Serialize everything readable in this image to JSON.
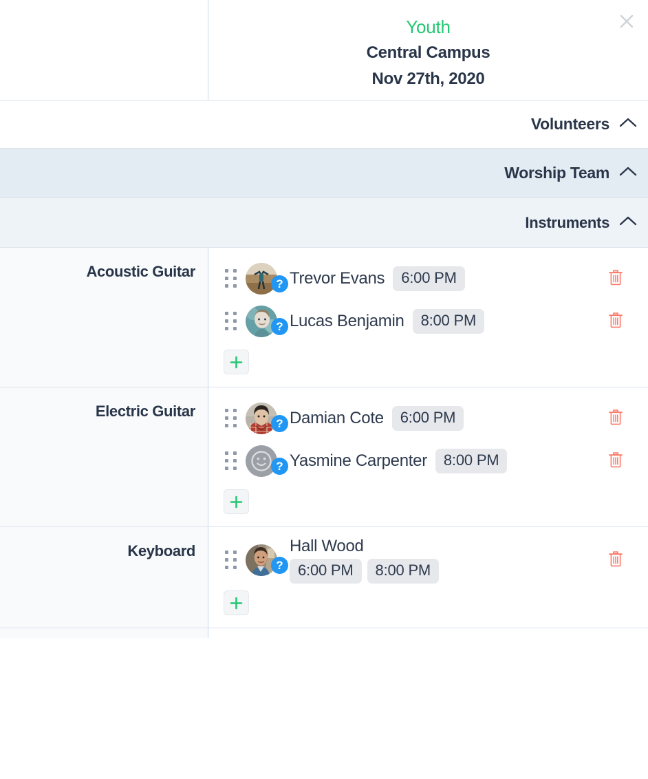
{
  "header": {
    "service_type": "Youth",
    "campus": "Central Campus",
    "date": "Nov 27th, 2020",
    "close_label": "×"
  },
  "colors": {
    "accent_green": "#25c772",
    "text_dark": "#293548",
    "badge_blue": "#2196f3",
    "trash_red": "#fb7b6b",
    "pill_bg": "#e6e8ec",
    "band_worship_bg": "#e3ebf3",
    "band_instruments_bg": "#eef3f8",
    "label_cell_bg": "#f8fafc"
  },
  "bands": [
    {
      "label": "Volunteers",
      "icon": "chevron-up-icon",
      "expanded": true
    },
    {
      "label": "Worship Team",
      "icon": "chevron-up-icon",
      "expanded": true
    },
    {
      "label": "Instruments",
      "icon": "chevron-up-icon",
      "expanded": true
    }
  ],
  "positions": [
    {
      "name": "Acoustic Guitar",
      "add_label": "+",
      "people": [
        {
          "name": "Trevor Evans",
          "status_icon": "question-badge-icon",
          "status_symbol": "?",
          "avatar": "photo-jumping-person",
          "times": [
            "6:00 PM"
          ],
          "stacked": false,
          "drag_icon": "drag-handle-icon",
          "delete_icon": "trash-icon"
        },
        {
          "name": "Lucas Benjamin",
          "status_icon": "question-badge-icon",
          "status_symbol": "?",
          "avatar": "photo-young-man-teal",
          "times": [
            "8:00 PM"
          ],
          "stacked": false,
          "drag_icon": "drag-handle-icon",
          "delete_icon": "trash-icon"
        }
      ]
    },
    {
      "name": "Electric Guitar",
      "add_label": "+",
      "people": [
        {
          "name": "Damian Cote",
          "status_icon": "question-badge-icon",
          "status_symbol": "?",
          "avatar": "photo-man-plaid-shirt",
          "times": [
            "6:00 PM"
          ],
          "stacked": false,
          "drag_icon": "drag-handle-icon",
          "delete_icon": "trash-icon"
        },
        {
          "name": "Yasmine Carpenter",
          "status_icon": "question-badge-icon",
          "status_symbol": "?",
          "avatar": "placeholder-smiley-avatar",
          "times": [
            "8:00 PM"
          ],
          "stacked": false,
          "drag_icon": "drag-handle-icon",
          "delete_icon": "trash-icon"
        }
      ]
    },
    {
      "name": "Keyboard",
      "add_label": "+",
      "people": [
        {
          "name": "Hall Wood",
          "status_icon": "question-badge-icon",
          "status_symbol": "?",
          "avatar": "photo-young-man-indoors",
          "times": [
            "6:00 PM",
            "8:00 PM"
          ],
          "stacked": true,
          "drag_icon": "drag-handle-icon",
          "delete_icon": "trash-icon"
        }
      ]
    }
  ]
}
